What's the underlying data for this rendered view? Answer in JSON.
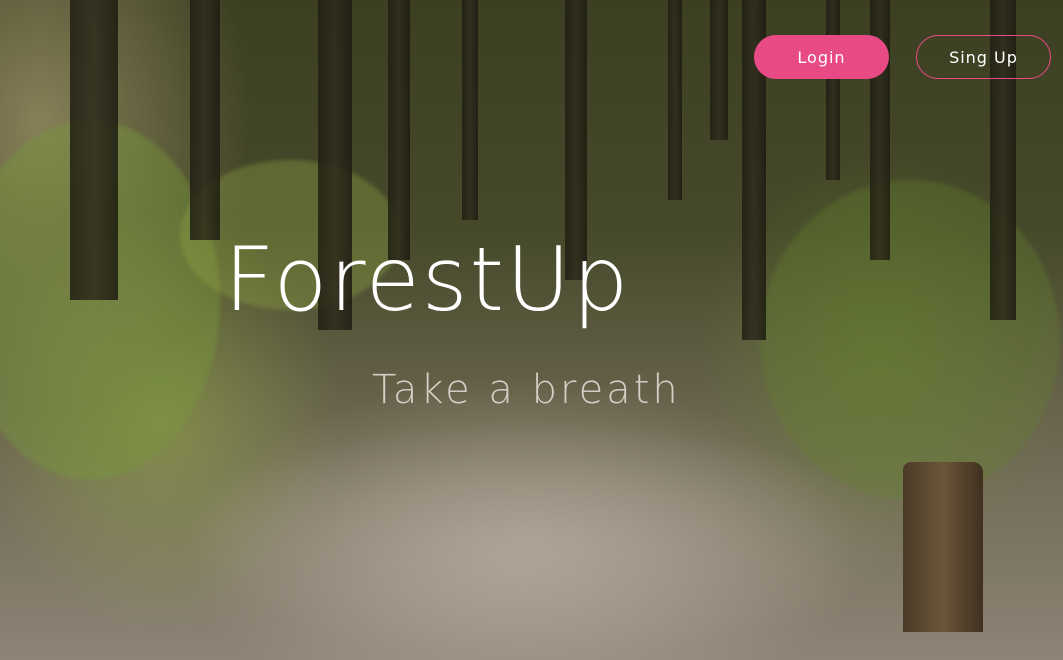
{
  "nav": {
    "login_label": "Login",
    "signup_label": "Sing Up"
  },
  "hero": {
    "title": "ForestUp",
    "subtitle": "Take a breath"
  },
  "colors": {
    "accent": "#e84a86",
    "text_primary": "#ffffff",
    "text_secondary": "#d5cdc5"
  }
}
